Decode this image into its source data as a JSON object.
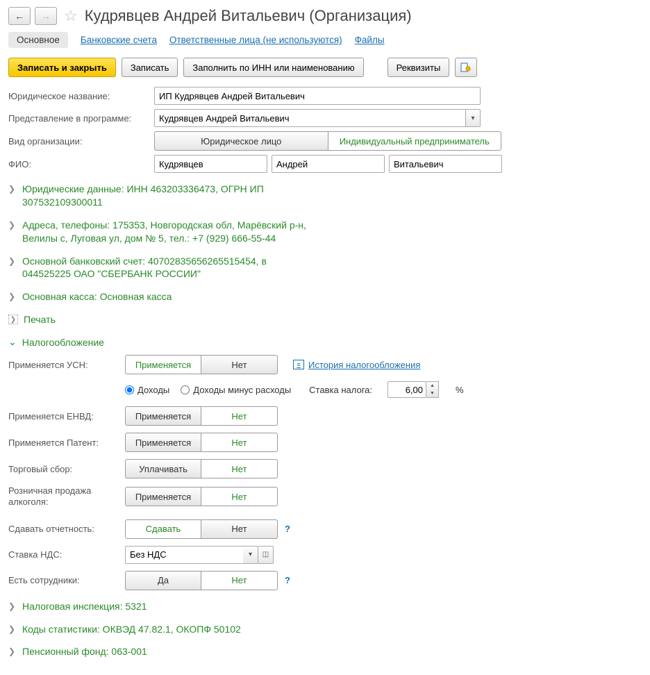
{
  "header": {
    "title": "Кудрявцев Андрей Витальевич (Организация)"
  },
  "tabs": {
    "main": "Основное",
    "bank": "Банковские счета",
    "resp": "Ответственные лица (не используются)",
    "files": "Файлы"
  },
  "toolbar": {
    "save_close": "Записать и закрыть",
    "save": "Записать",
    "fill_by_inn": "Заполнить по ИНН или наименованию",
    "requisites": "Реквизиты"
  },
  "fields": {
    "legal_name_label": "Юридическое название:",
    "legal_name": "ИП Кудрявцев Андрей Витальевич",
    "display_name_label": "Представление в программе:",
    "display_name": "Кудрявцев Андрей Витальевич",
    "org_type_label": "Вид организации:",
    "org_type_legal": "Юридическое лицо",
    "org_type_ip": "Индивидуальный предприниматель",
    "fio_label": "ФИО:",
    "surname": "Кудрявцев",
    "first_name": "Андрей",
    "patronymic": "Витальевич"
  },
  "sections": {
    "legal_data": "Юридические данные: ИНН 463203336473, ОГРН ИП 307532109300011",
    "addresses": "Адреса, телефоны: 175353, Новгородская обл, Марёвский р-н, Велилы с, Луговая ул, дом № 5, тел.: +7 (929) 666-55-44",
    "bank_account": "Основной банковский счет: 40702835656265515454, в 044525225 ОАО \"СБЕРБАНК РОССИИ\"",
    "main_cash": "Основная касса: Основная касса",
    "print": "Печать",
    "taxation": "Налогообложение",
    "tax_inspection": "Налоговая инспекция: 5321",
    "stat_codes": "Коды статистики: ОКВЭД 47.82.1, ОКОПФ 50102",
    "pension_fund": "Пенсионный фонд: 063-001"
  },
  "tax": {
    "usn_label": "Применяется УСН:",
    "applied": "Применяется",
    "not": "Нет",
    "history_link": "История налогообложения",
    "income": "Доходы",
    "income_minus": "Доходы минус расходы",
    "rate_label": "Ставка налога:",
    "rate_value": "6,00",
    "percent": "%",
    "envd_label": "Применяется ЕНВД:",
    "patent_label": "Применяется Патент:",
    "trade_fee_label": "Торговый сбор:",
    "trade_fee_pay": "Уплачивать",
    "alcohol_label": "Розничная продажа алкоголя:",
    "report_label": "Сдавать отчетность:",
    "report_yes": "Сдавать",
    "nds_label": "Ставка НДС:",
    "nds_value": "Без НДС",
    "employees_label": "Есть сотрудники:",
    "yes": "Да"
  }
}
